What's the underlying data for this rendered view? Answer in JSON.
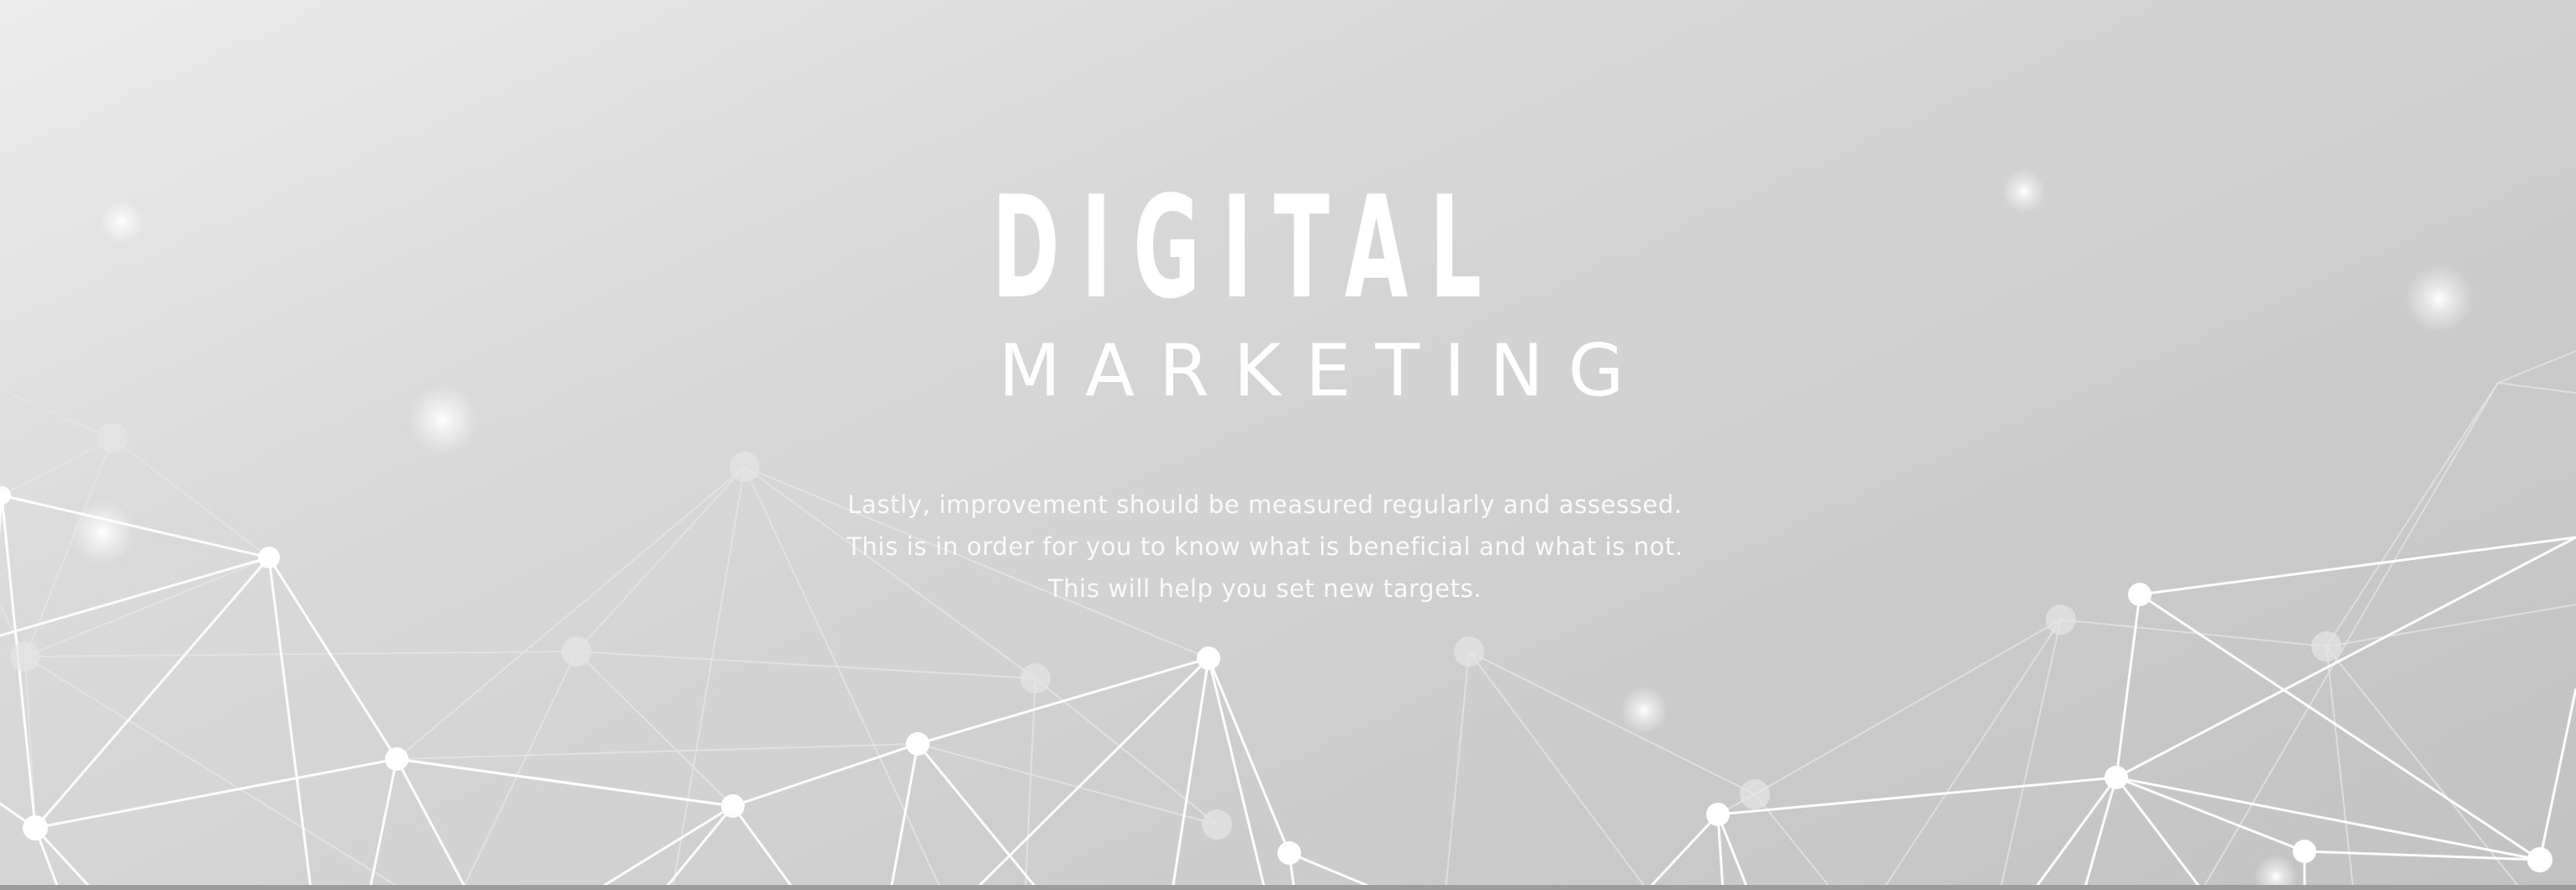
{
  "banner": {
    "title": "DIGITAL",
    "subtitle": "MARKETING",
    "body_lines": [
      "Lastly, improvement should be measured regularly and assessed.",
      "This is in order for you to know what is beneficial and what is not.",
      "This will help you set new targets."
    ]
  },
  "colors": {
    "text": "#ffffff",
    "network_primary": "#ffffff",
    "network_secondary": "#e6e6e6",
    "background_light": "#ececec",
    "background_dark": "#c2c2c2"
  }
}
